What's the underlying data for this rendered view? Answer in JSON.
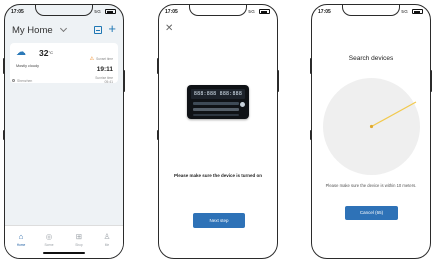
{
  "status_bar": {
    "time": "17:05",
    "signal": "5G"
  },
  "screen1": {
    "home_title": "My Home",
    "weather": {
      "temperature": "32",
      "temperature_unit": "°C",
      "description": "Mostly cloudy",
      "sunset_label": "Sunset time",
      "sunset_time": "19:11",
      "sunrise_label": "Sunrise time",
      "sunrise_time": "05:41"
    },
    "location": "Shenzhen",
    "tabs": [
      {
        "label": "Home",
        "icon": "home-icon",
        "active": true
      },
      {
        "label": "Scene",
        "icon": "scene-icon",
        "active": false
      },
      {
        "label": "Shop",
        "icon": "shop-icon",
        "active": false
      },
      {
        "label": "Me",
        "icon": "me-icon",
        "active": false
      }
    ]
  },
  "screen2": {
    "device_display": "888:888 888:888",
    "message": "Please make sure the device is turned on",
    "next_button": "Next step"
  },
  "screen3": {
    "title": "Search devices",
    "message": "Please make sure the device is within 10 meters.",
    "cancel_button": "Cancel (65)"
  },
  "colors": {
    "accent": "#2e72b7",
    "nav_active": "#1f5fa3",
    "warning": "#f08a24",
    "radar_sweep": "#f2c94c",
    "home_bg": "#eef2f5"
  }
}
